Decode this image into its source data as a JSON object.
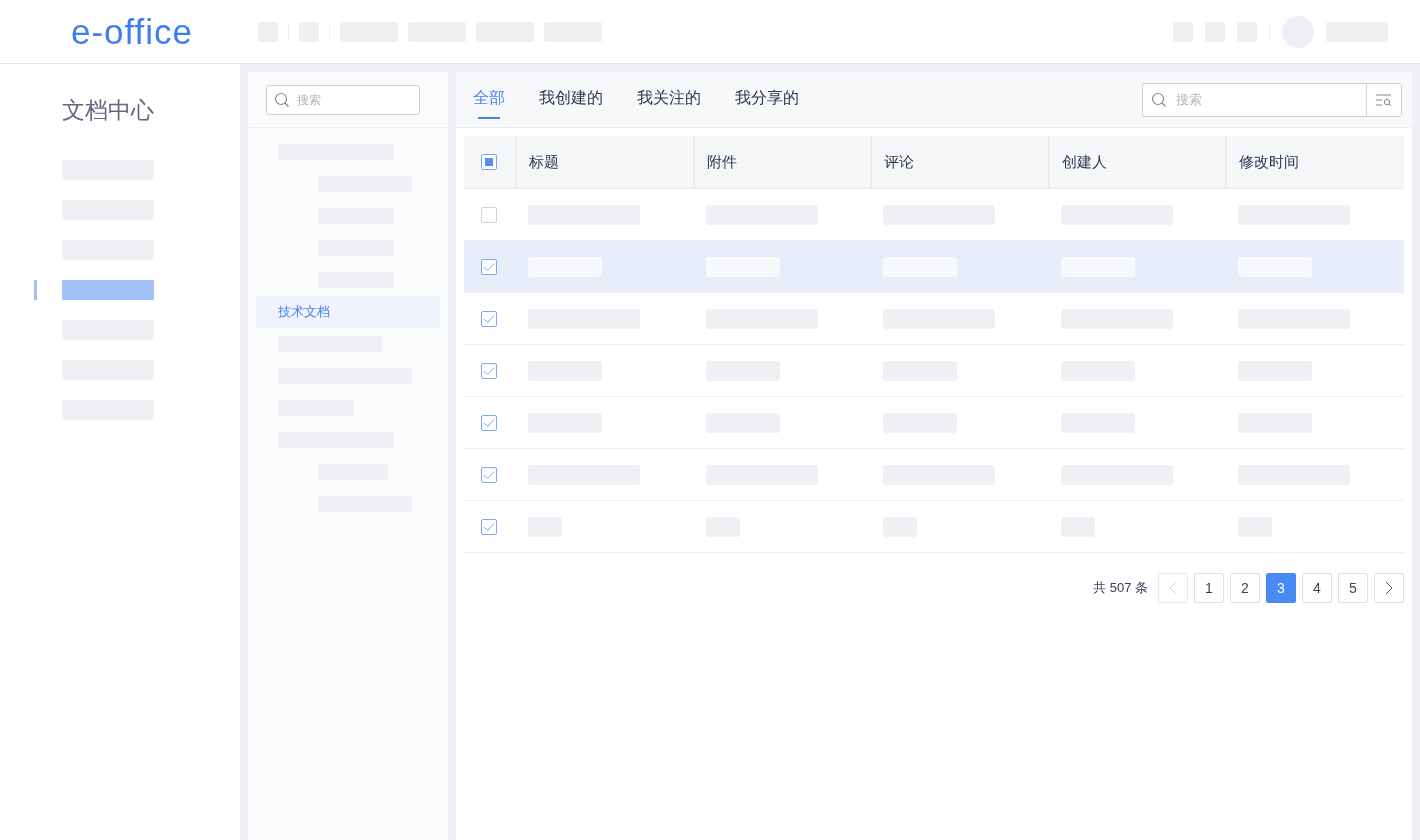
{
  "logo": "e-office",
  "sidebar": {
    "title": "文档中心",
    "items": [
      {
        "selected": false
      },
      {
        "selected": false
      },
      {
        "selected": false
      },
      {
        "selected": true
      },
      {
        "selected": false
      },
      {
        "selected": false
      },
      {
        "selected": false
      }
    ]
  },
  "tree": {
    "search": {
      "placeholder": "搜索"
    },
    "nodes": [
      {
        "selected": false,
        "children": [
          {
            "selected": false
          },
          {
            "selected": false
          },
          {
            "selected": false
          },
          {
            "selected": false
          }
        ]
      },
      {
        "label": "技术文档",
        "selected": true
      },
      {
        "selected": false
      },
      {
        "selected": false
      },
      {
        "selected": false
      },
      {
        "selected": false,
        "children": [
          {
            "selected": false
          },
          {
            "selected": false
          }
        ]
      }
    ]
  },
  "tabs": [
    {
      "label": "全部",
      "selected": true
    },
    {
      "label": "我创建的",
      "selected": false
    },
    {
      "label": "我关注的",
      "selected": false
    },
    {
      "label": "我分享的",
      "selected": false
    }
  ],
  "search": {
    "placeholder": "搜索"
  },
  "table": {
    "header_checkbox": {
      "indeterminate": true
    },
    "columns": [
      "标题",
      "附件",
      "评论",
      "创建人",
      "修改时间"
    ],
    "rows": [
      {
        "checked": false,
        "selected": false
      },
      {
        "checked": true,
        "selected": true
      },
      {
        "checked": true,
        "selected": false
      },
      {
        "checked": true,
        "selected": false
      },
      {
        "checked": true,
        "selected": false
      },
      {
        "checked": true,
        "selected": false
      },
      {
        "checked": true,
        "selected": false
      }
    ]
  },
  "pagination": {
    "total": "共 507 条",
    "prev": {
      "disabled": true
    },
    "next": {
      "disabled": false
    },
    "pages": [
      {
        "label": "1",
        "selected": false
      },
      {
        "label": "2",
        "selected": false
      },
      {
        "label": "3",
        "selected": true
      },
      {
        "label": "4",
        "selected": false
      },
      {
        "label": "5",
        "selected": false
      }
    ]
  }
}
